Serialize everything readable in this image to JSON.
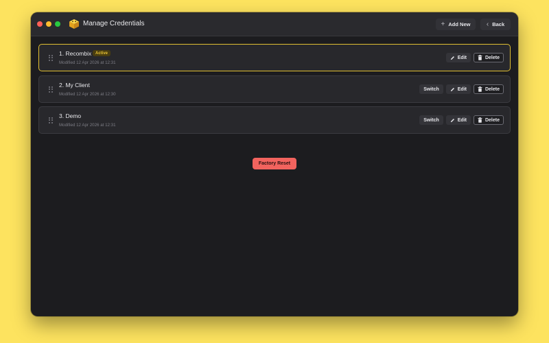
{
  "window": {
    "title": "Manage Credentials",
    "app_icon": "yellow-cube-icon"
  },
  "toolbar": {
    "add_new": {
      "icon": "plus-icon",
      "glyph": "+",
      "label": "Add New"
    },
    "back": {
      "icon": "chevron-left-icon",
      "glyph": "‹",
      "label": "Back"
    }
  },
  "credentials": [
    {
      "name": "1. Recombix",
      "badge": "Active",
      "modified": "Modified 12 Apr 2026 at 12:31",
      "active": true
    },
    {
      "name": "2. My Client",
      "modified": "Modified 12 Apr 2026 at 12:30",
      "active": false
    },
    {
      "name": "3. Demo",
      "modified": "Modified 12 Apr 2026 at 12:31",
      "active": false
    }
  ],
  "row_actions": {
    "switch": "Switch",
    "edit": "Edit",
    "delete": "Delete"
  },
  "factory_reset": {
    "label": "Factory Reset"
  },
  "colors": {
    "background": "#fde35f",
    "active_border": "#e2c032",
    "danger": "#f2635e"
  }
}
